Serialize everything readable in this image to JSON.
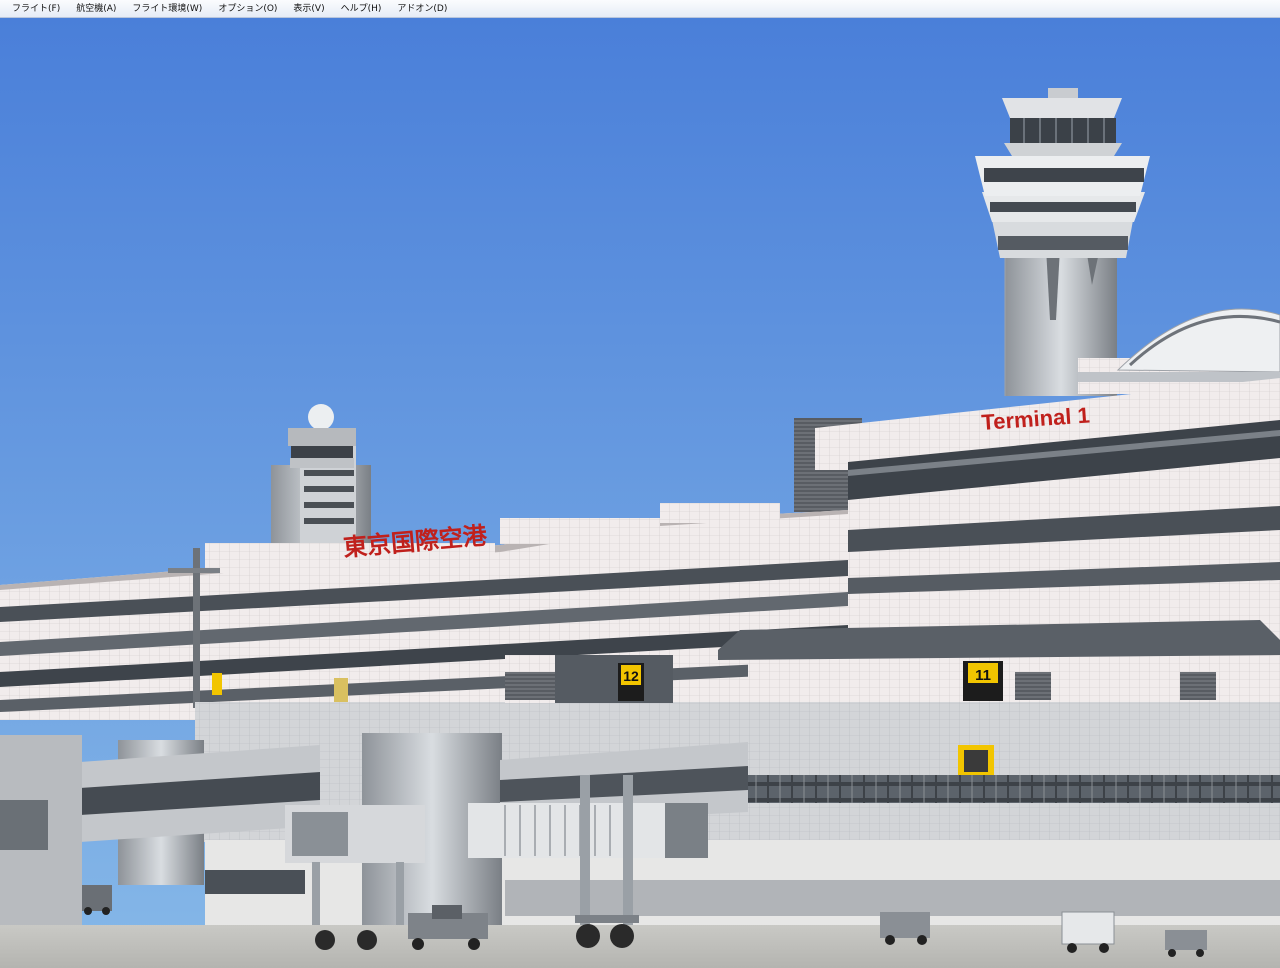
{
  "menubar": {
    "items": [
      {
        "label": "フライト(F)"
      },
      {
        "label": "航空機(A)"
      },
      {
        "label": "フライト環境(W)"
      },
      {
        "label": "オプション(O)"
      },
      {
        "label": "表示(V)"
      },
      {
        "label": "ヘルプ(H)"
      },
      {
        "label": "アドオン(D)"
      }
    ]
  },
  "scene": {
    "terminal_sign": "Terminal 1",
    "airport_sign": "東京国際空港",
    "gates": [
      {
        "number": "12"
      },
      {
        "number": "11"
      }
    ],
    "colors": {
      "sky_top": "#4a7fd9",
      "sky_bottom": "#7fb2e6",
      "sign_red": "#c0201c",
      "gate_sign_yellow": "#f2c500"
    }
  }
}
